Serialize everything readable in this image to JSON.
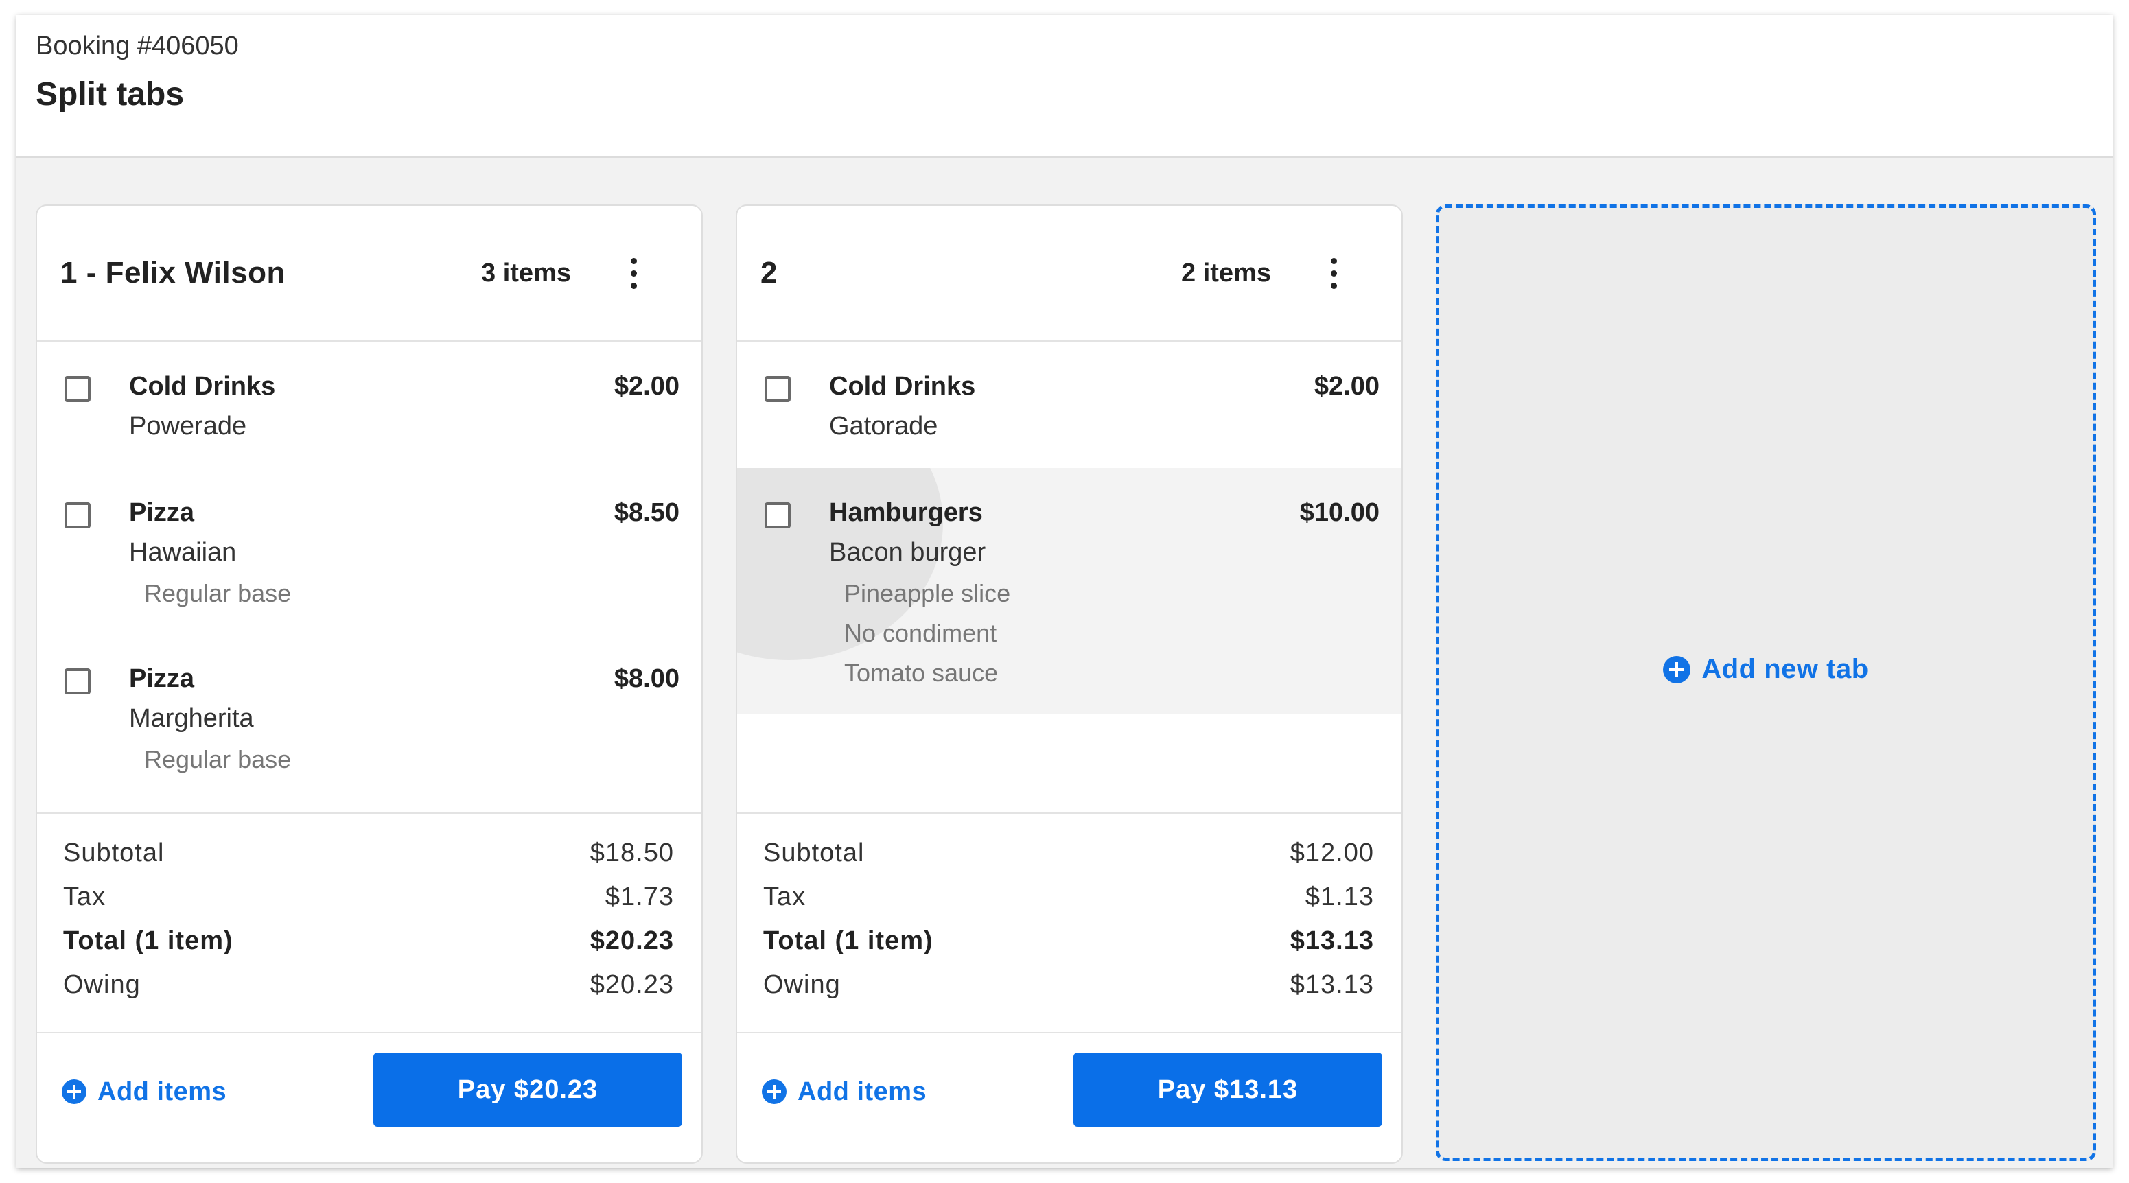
{
  "header": {
    "booking": "Booking #406050",
    "title": "Split tabs"
  },
  "tabs": [
    {
      "name": "1 - Felix Wilson",
      "count": "3 items",
      "items": [
        {
          "name": "Cold Drinks",
          "sub": "Powerade",
          "mods": [],
          "price": "$2.00"
        },
        {
          "name": "Pizza",
          "sub": "Hawaiian",
          "mods": [
            "Regular base"
          ],
          "price": "$8.50"
        },
        {
          "name": "Pizza",
          "sub": "Margherita",
          "mods": [
            "Regular base"
          ],
          "price": "$8.00"
        }
      ],
      "totals": {
        "subtotal_label": "Subtotal",
        "subtotal": "$18.50",
        "tax_label": "Tax",
        "tax": "$1.73",
        "total_label": "Total (1 item)",
        "total": "$20.23",
        "owing_label": "Owing",
        "owing": "$20.23"
      },
      "add_items_label": "Add items",
      "pay_label": "Pay $20.23"
    },
    {
      "name": "2",
      "count": "2 items",
      "items": [
        {
          "name": "Cold Drinks",
          "sub": "Gatorade",
          "mods": [],
          "price": "$2.00"
        },
        {
          "name": "Hamburgers",
          "sub": "Bacon burger",
          "mods": [
            "Pineapple slice",
            "No condiment",
            "Tomato sauce"
          ],
          "price": "$10.00"
        }
      ],
      "totals": {
        "subtotal_label": "Subtotal",
        "subtotal": "$12.00",
        "tax_label": "Tax",
        "tax": "$1.13",
        "total_label": "Total (1 item)",
        "total": "$13.13",
        "owing_label": "Owing",
        "owing": "$13.13"
      },
      "add_items_label": "Add items",
      "pay_label": "Pay $13.13"
    }
  ],
  "new_tab_label": "Add new tab",
  "colors": {
    "accent": "#1173e6",
    "button": "#0a6fe8",
    "background": "#f2f2f2"
  }
}
